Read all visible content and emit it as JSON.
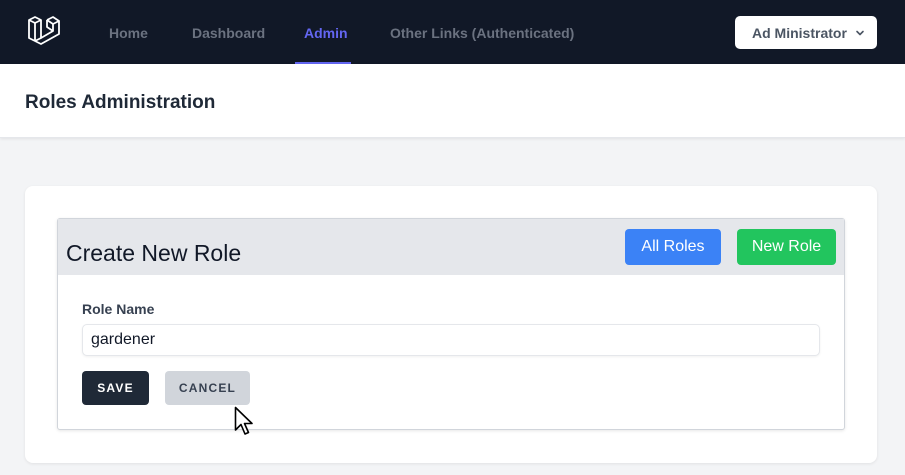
{
  "nav": {
    "logo": "laravel-logo-icon",
    "links": [
      {
        "label": "Home",
        "active": false
      },
      {
        "label": "Dashboard",
        "active": false
      },
      {
        "label": "Admin",
        "active": true
      },
      {
        "label": "Other Links (Authenticated)",
        "active": false
      }
    ],
    "user_menu": {
      "label": "Ad Ministrator",
      "icon": "chevron-down-icon"
    }
  },
  "header": {
    "title": "Roles Administration"
  },
  "panel": {
    "title": "Create New Role",
    "all_roles_label": "All Roles",
    "new_role_label": "New Role"
  },
  "form": {
    "role_name_label": "Role Name",
    "role_name_value": "gardener",
    "save_label": "SAVE",
    "cancel_label": "CANCEL"
  },
  "colors": {
    "nav_bg": "#111827",
    "accent": "#6366f1",
    "blue_button": "#3b82f6",
    "green_button": "#22c55e",
    "save_button": "#1f2937",
    "cancel_button": "#d1d5db"
  }
}
